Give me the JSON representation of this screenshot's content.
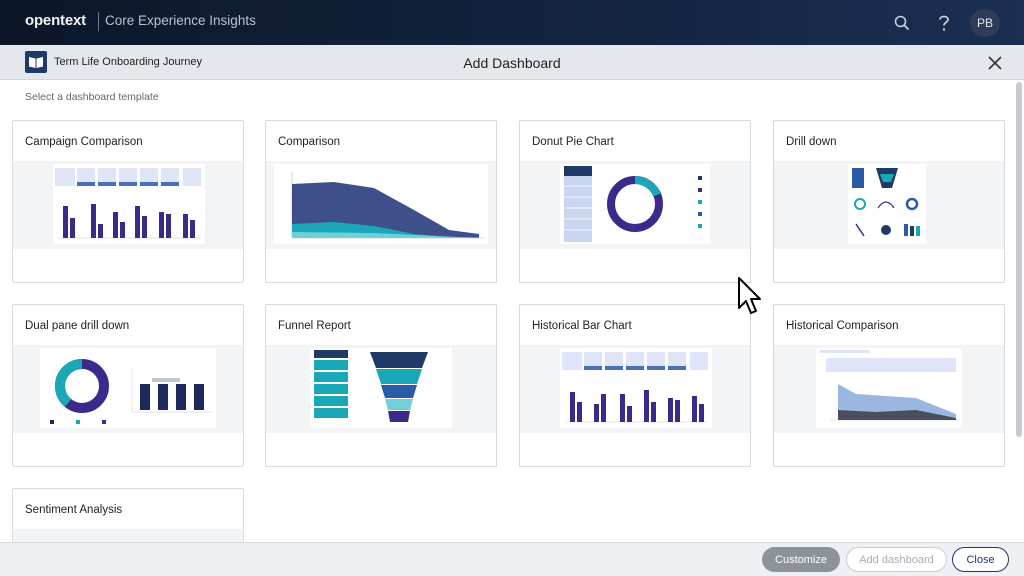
{
  "app": {
    "brand": "opentext",
    "product": "Core Experience Insights"
  },
  "topbar": {
    "icons": [
      "search-icon",
      "help-icon"
    ],
    "avatar_initials": "PB"
  },
  "modal": {
    "journey_name": "Term Life Onboarding Journey",
    "title": "Add Dashboard",
    "subtitle": "Select a dashboard template"
  },
  "templates": [
    {
      "label": "Campaign Comparison"
    },
    {
      "label": "Comparison"
    },
    {
      "label": "Donut Pie Chart"
    },
    {
      "label": "Drill down"
    },
    {
      "label": "Dual pane drill down"
    },
    {
      "label": "Funnel Report"
    },
    {
      "label": "Historical Bar Chart"
    },
    {
      "label": "Historical Comparison"
    },
    {
      "label": "Sentiment Analysis"
    }
  ],
  "footer": {
    "customize": "Customize",
    "add_dashboard": "Add dashboard",
    "close": "Close"
  },
  "colors": {
    "accent": "#1f3a66",
    "navy": "#3b2a8c",
    "teal": "#1aa7b8",
    "sky": "#9bb6e0"
  }
}
